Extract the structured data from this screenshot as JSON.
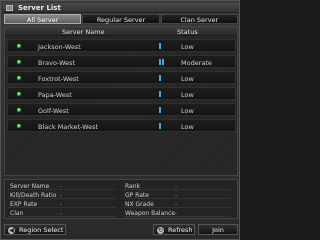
{
  "window": {
    "title": "Server List"
  },
  "tabs": [
    {
      "label": "All Server",
      "active": true
    },
    {
      "label": "Regular Server",
      "active": false
    },
    {
      "label": "Clan Server",
      "active": false
    }
  ],
  "list": {
    "columns": {
      "name": "Server Name",
      "status": "Status"
    },
    "rows": [
      {
        "name": "Jackson-West",
        "status": "Low",
        "bars": 1
      },
      {
        "name": "Bravo-West",
        "status": "Moderate",
        "bars": 2
      },
      {
        "name": "Foxtrot-West",
        "status": "Low",
        "bars": 1
      },
      {
        "name": "Papa-West",
        "status": "Low",
        "bars": 1
      },
      {
        "name": "Golf-West",
        "status": "Low",
        "bars": 1
      },
      {
        "name": "Black Market-West",
        "status": "Low",
        "bars": 1
      }
    ]
  },
  "info": {
    "left": [
      {
        "key": "Server Name",
        "value": "-"
      },
      {
        "key": "Kill/Death Ratio",
        "value": "-"
      },
      {
        "key": "EXP Rate",
        "value": "-"
      },
      {
        "key": "Clan",
        "value": "-"
      }
    ],
    "right": [
      {
        "key": "Rank",
        "value": "-"
      },
      {
        "key": "GP Rate",
        "value": "-"
      },
      {
        "key": "NX Grade",
        "value": "-"
      },
      {
        "key": "Weapon Balance",
        "value": "-"
      }
    ]
  },
  "buttons": {
    "region_select": "Region Select",
    "refresh": "Refresh",
    "join": "Join"
  },
  "icons": {
    "online": "online-indicator-icon",
    "signal": "signal-bars-icon",
    "back": "back-arrow-icon",
    "refresh": "refresh-icon"
  },
  "colors": {
    "active_tab": "#6e6e6e",
    "online_dot": "#2aa74a",
    "signal_bar": "#3aa7d8"
  }
}
